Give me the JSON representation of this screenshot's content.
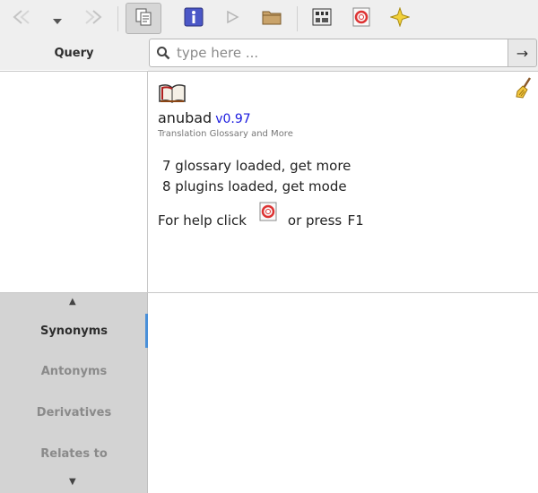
{
  "toolbar": {
    "buttons": [
      {
        "name": "back-button",
        "icon": "back-arrow-icon",
        "enabled": false
      },
      {
        "name": "history-dropdown",
        "icon": "chevron-down-icon",
        "enabled": true
      },
      {
        "name": "forward-button",
        "icon": "forward-arrow-icon",
        "enabled": false
      },
      {
        "name": "copy-button",
        "icon": "copy-icon",
        "active": true
      },
      {
        "name": "info-button",
        "icon": "info-icon"
      },
      {
        "name": "play-button",
        "icon": "play-icon",
        "enabled": false
      },
      {
        "name": "open-folder-button",
        "icon": "folder-icon"
      },
      {
        "name": "dictionary-manager-button",
        "icon": "dictionary-manager-icon"
      },
      {
        "name": "help-button",
        "icon": "lifebuoy-icon"
      },
      {
        "name": "favorites-button",
        "icon": "star-icon"
      }
    ]
  },
  "query": {
    "label": "Query",
    "placeholder": "type here ...",
    "value": "",
    "go_label": "→"
  },
  "info": {
    "app_name": "anubad",
    "version": "v0.97",
    "subtitle": "Translation Glossary and More",
    "glossary_status": "7 glossary loaded, get more",
    "plugins_status": "8 plugins loaded, get mode",
    "help_prefix": "For help click",
    "help_suffix": "or press",
    "help_key": "F1"
  },
  "relations": {
    "up_arrow": "▲",
    "down_arrow": "▼",
    "items": [
      {
        "label": "Synonyms",
        "selected": true
      },
      {
        "label": "Antonyms",
        "selected": false
      },
      {
        "label": "Derivatives",
        "selected": false
      },
      {
        "label": "Relates to",
        "selected": false
      }
    ]
  },
  "colors": {
    "accent": "#4a90d9",
    "version": "#1a1adf",
    "toolbar_bg": "#efefef",
    "sidebar_bg": "#d3d3d3"
  }
}
